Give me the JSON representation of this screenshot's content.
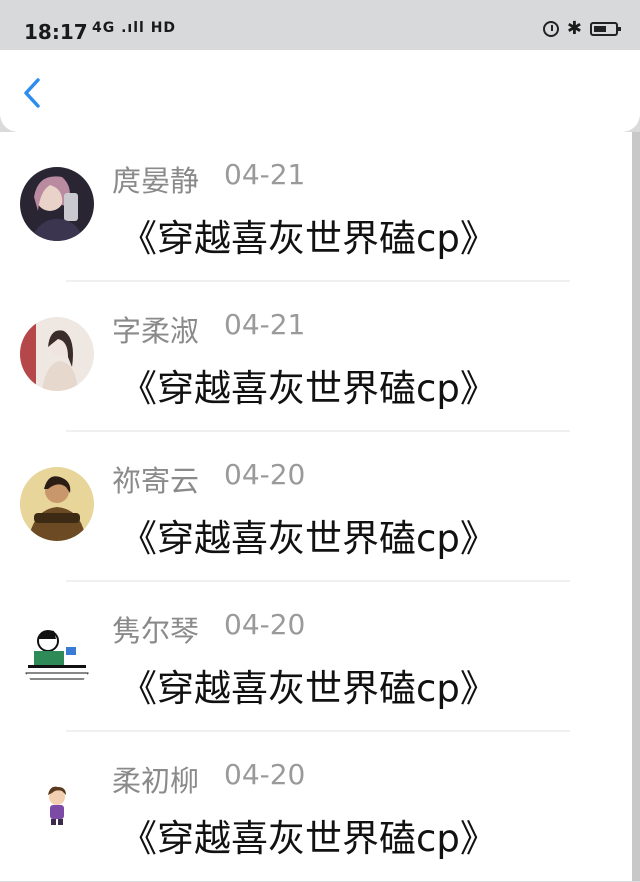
{
  "status_bar": {
    "time": "18:17",
    "signal": "4G .ıll HD",
    "bluetooth_glyph": "✱"
  },
  "header": {
    "back_icon": "chevron-left-icon",
    "accent": "#2d8cf0"
  },
  "comments": [
    {
      "username": "庹晏静",
      "date": "04-21",
      "text": "《穿越喜灰世界磕cp》"
    },
    {
      "username": "字柔淑",
      "date": "04-21",
      "text": "《穿越喜灰世界磕cp》"
    },
    {
      "username": "祢寄云",
      "date": "04-20",
      "text": "《穿越喜灰世界磕cp》"
    },
    {
      "username": "隽尔琴",
      "date": "04-20",
      "text": "《穿越喜灰世界磕cp》"
    },
    {
      "username": "柔初柳",
      "date": "04-20",
      "text": "《穿越喜灰世界磕cp》"
    }
  ]
}
